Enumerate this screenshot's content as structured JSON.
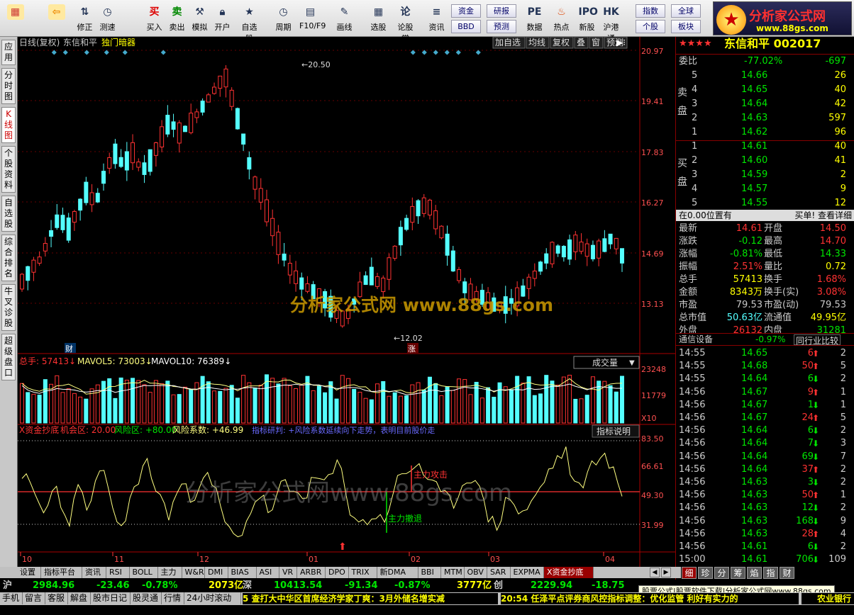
{
  "toolbar": {
    "buttons": [
      {
        "label": "",
        "icon": "windows-icon"
      },
      {
        "label": "",
        "icon": "back-arrow-icon"
      },
      {
        "label": "修正",
        "icon": "up-down-icon"
      },
      {
        "label": "测速",
        "icon": "clock-icon"
      },
      {
        "label": "买入",
        "icon": "buy-icon"
      },
      {
        "label": "卖出",
        "icon": "sell-icon"
      },
      {
        "label": "模拟",
        "icon": "hammer-icon"
      },
      {
        "label": "开户",
        "icon": "lock-icon"
      },
      {
        "label": "自选股",
        "icon": "star-icon"
      },
      {
        "label": "周期",
        "icon": "clock-icon"
      },
      {
        "label": "F10/F9",
        "icon": "document-icon"
      },
      {
        "label": "画线",
        "icon": "pen-icon"
      },
      {
        "label": "选股",
        "icon": "grid-icon"
      },
      {
        "label": "论股堂",
        "icon": "forum-icon"
      },
      {
        "label": "资讯",
        "icon": "news-icon"
      },
      {
        "label": "数据",
        "icon": "pe-icon"
      },
      {
        "label": "热点",
        "icon": "fire-icon"
      },
      {
        "label": "新股",
        "icon": "newstock-icon"
      },
      {
        "label": "沪港通",
        "icon": "hk-icon"
      }
    ],
    "small_buttons": [
      "资金",
      "研报",
      "BBD",
      "预测",
      "指数",
      "全球",
      "个股",
      "板块"
    ]
  },
  "brand": {
    "line1": "分析家公式网",
    "line2": "www.88gs.com"
  },
  "side_tabs": [
    "应用",
    "分时图",
    "K线图",
    "个股资料",
    "自选股",
    "综合排名",
    "牛叉诊股",
    "超级盘口"
  ],
  "chart": {
    "header": {
      "mode": "日线(复权)",
      "name": "东信和平",
      "indicator": "独门暗器"
    },
    "header_buttons": [
      "加自选",
      "均线",
      "复权",
      "叠",
      "窗",
      "预测"
    ],
    "price_axis": [
      "20.97",
      "19.41",
      "17.83",
      "16.27",
      "14.69",
      "13.13"
    ],
    "high_label": "20.50",
    "low_label": "12.02",
    "cai_label": "财",
    "zhang_label": "涨",
    "watermark": "分析家公式网 www.88gs.com",
    "volume": {
      "title": "总手: 57413",
      "mavol5": "MAVOL5: 73003",
      "mavol10": "MAVOL10: 76389",
      "axis": [
        "23248",
        "11779"
      ],
      "unit": "X10",
      "dropdown": "成交量"
    },
    "indicator": {
      "title": "X资金抄底",
      "opp": "机会区: 20.00",
      "risk": "风险区: +80.00",
      "coef": "风险系数: +46.99",
      "analysis": "指标研判: +风险系数延续向下走势，表明目前股价走",
      "button": "指标说明",
      "axis": [
        "83.50",
        "66.61",
        "49.30",
        "31.99"
      ],
      "buy_label": "主力攻击",
      "sell_label": "主力撤退",
      "watermark": "分析家公式网www.88gs.com"
    },
    "dates": [
      "10",
      "11",
      "12",
      "01",
      "02",
      "03",
      "04"
    ]
  },
  "quote": {
    "stars": "★★★★",
    "stock": "东信和平 002017",
    "weibi": {
      "label": "委比",
      "pct": "-77.02%",
      "diff": "-697"
    },
    "sell_label": "卖盘",
    "buy_label": "买盘",
    "asks": [
      [
        "5",
        "14.66",
        "26"
      ],
      [
        "4",
        "14.65",
        "40"
      ],
      [
        "3",
        "14.64",
        "42"
      ],
      [
        "2",
        "14.63",
        "597"
      ],
      [
        "1",
        "14.62",
        "96"
      ]
    ],
    "bids": [
      [
        "1",
        "14.61",
        "40"
      ],
      [
        "2",
        "14.60",
        "41"
      ],
      [
        "3",
        "14.59",
        "2"
      ],
      [
        "4",
        "14.57",
        "9"
      ],
      [
        "5",
        "14.55",
        "12"
      ]
    ],
    "position": "在0.00位置有",
    "position_link": "买单! 查看详细",
    "stats": [
      [
        "最新",
        "14.61",
        "开盘",
        "14.50"
      ],
      [
        "涨跌",
        "-0.12",
        "最高",
        "14.70"
      ],
      [
        "涨幅",
        "-0.81%",
        "最低",
        "14.33"
      ],
      [
        "振幅",
        "2.51%",
        "量比",
        "0.72"
      ],
      [
        "总手",
        "57413",
        "换手",
        "1.68%"
      ],
      [
        "金额",
        "8343万",
        "换手(实)",
        "3.08%"
      ],
      [
        "市盈",
        "79.53",
        "市盈(动)",
        "79.53"
      ],
      [
        "总市值",
        "50.63亿",
        "流通值",
        "49.95亿"
      ],
      [
        "外盘",
        "26132",
        "内盘",
        "31281"
      ]
    ],
    "industry": {
      "name": "通信设备",
      "pct": "-0.97%",
      "link": "同行业比较"
    },
    "ticks": [
      [
        "14:55",
        "14.65",
        "6",
        "up",
        "2"
      ],
      [
        "14:55",
        "14.68",
        "50",
        "up",
        "5"
      ],
      [
        "14:55",
        "14.64",
        "6",
        "dn",
        "2"
      ],
      [
        "14:56",
        "14.67",
        "9",
        "up",
        "1"
      ],
      [
        "14:56",
        "14.67",
        "1",
        "dn",
        "1"
      ],
      [
        "14:56",
        "14.67",
        "24",
        "up",
        "5"
      ],
      [
        "14:56",
        "14.64",
        "6",
        "dn",
        "2"
      ],
      [
        "14:56",
        "14.64",
        "7",
        "dn",
        "3"
      ],
      [
        "14:56",
        "14.64",
        "69",
        "dn",
        "7"
      ],
      [
        "14:56",
        "14.64",
        "37",
        "up",
        "2"
      ],
      [
        "14:56",
        "14.63",
        "3",
        "dn",
        "2"
      ],
      [
        "14:56",
        "14.63",
        "50",
        "up",
        "1"
      ],
      [
        "14:56",
        "14.63",
        "12",
        "dn",
        "2"
      ],
      [
        "14:56",
        "14.63",
        "168",
        "dn",
        "9"
      ],
      [
        "14:56",
        "14.63",
        "28",
        "up",
        "4"
      ],
      [
        "14:56",
        "14.61",
        "6",
        "dn",
        "2"
      ],
      [
        "15:00",
        "14.61",
        "706",
        "dn",
        "109"
      ]
    ],
    "tabs": [
      "细",
      "珍",
      "分",
      "筹",
      "焰",
      "指",
      "财"
    ]
  },
  "bottom_tabs": [
    "设置",
    "指标平台",
    "资讯",
    "RSI",
    "BOLL",
    "主力",
    "W&R",
    "DMI",
    "BIAS",
    "ASI",
    "VR",
    "ARBR",
    "DPO",
    "TRIX",
    "新DMA",
    "BBI",
    "MTM",
    "OBV",
    "SAR",
    "EXPMA",
    "X资金抄底"
  ],
  "status": {
    "sh": [
      "沪",
      "2984.96",
      "-23.46",
      "-0.78%",
      "2073亿"
    ],
    "sz": [
      "深",
      "10413.54",
      "-91.34",
      "-0.87%",
      "3777亿"
    ],
    "cy": [
      "创",
      "2229.94",
      "-18.75"
    ],
    "notice": "股票公式|股票软件下载|分析家公式网www.88gs.com",
    "news_left": "5 查打大中华区首席经济学家丁爽：3月外储名增实减",
    "news_right": "20:54 任泽平点评券商风控指标调整：优化监管 利好有实力的",
    "right_label": "农业银行"
  },
  "menu2": [
    "手机",
    "留言",
    "客服",
    "解盘",
    "股市日记",
    "股灵通",
    "行情",
    "24小时滚动"
  ]
}
